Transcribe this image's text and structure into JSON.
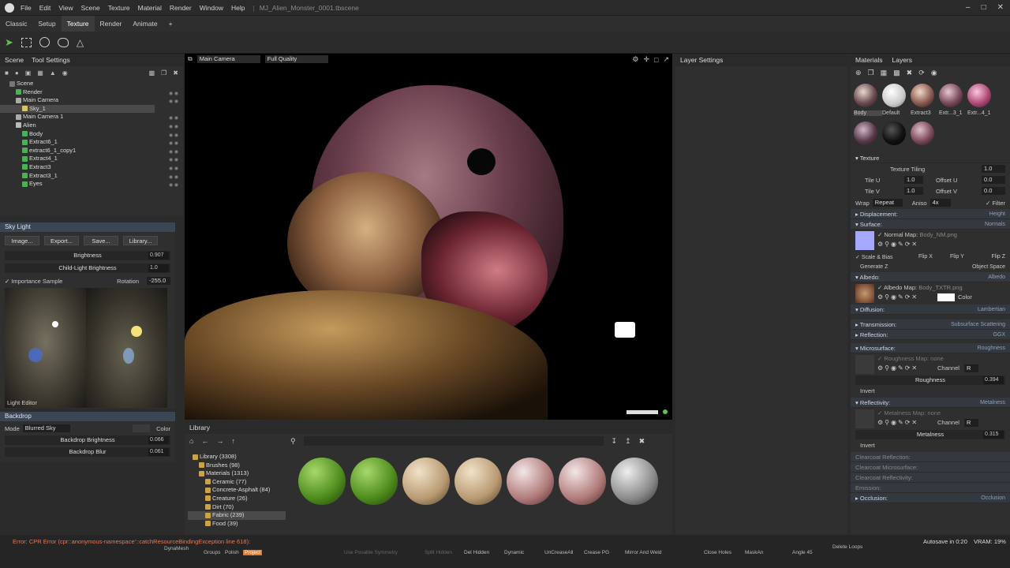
{
  "titlebar": {
    "menu": [
      "File",
      "Edit",
      "View",
      "Scene",
      "Texture",
      "Material",
      "Render",
      "Window",
      "Help"
    ],
    "filename": "MJ_Alien_Monster_0001.tbscene"
  },
  "tabs": [
    "Classic",
    "Setup",
    "Texture",
    "Render",
    "Animate",
    "+"
  ],
  "scene_panel": {
    "tabs": [
      "Scene",
      "Tool Settings"
    ],
    "tree": [
      "Scene",
      "Render",
      "Main Camera",
      "Sky_1",
      "Main Camera 1",
      "Alien",
      "Body",
      "Extract6_1",
      "extract6_1_copy1",
      "Extract4_1",
      "Extract3",
      "Extract3_1",
      "Eyes"
    ]
  },
  "sky_light": {
    "title": "Sky Light",
    "buttons": [
      "Image...",
      "Export...",
      "Save...",
      "Library..."
    ],
    "brightness_label": "Brightness",
    "brightness": "0.907",
    "child_label": "Child-Light Brightness",
    "child": "1.0",
    "importance": "Importance Sample",
    "rotation_label": "Rotation",
    "rotation": "-255.0",
    "light_editor": "Light Editor"
  },
  "backdrop": {
    "title": "Backdrop",
    "mode_label": "Mode",
    "mode": "Blurred Sky",
    "color_label": "Color",
    "brightness_label": "Backdrop Brightness",
    "brightness": "0.066",
    "blur_label": "Backdrop Blur",
    "blur": "0.061"
  },
  "viewport": {
    "camera": "Main Camera",
    "quality": "Full Quality"
  },
  "layer_settings": {
    "title": "Layer Settings"
  },
  "library": {
    "tab": "Library",
    "tree": [
      "Library (3308)",
      "Brushes (98)",
      "Materials (1313)",
      "Ceramic (77)",
      "Concrete-Asphalt (84)",
      "Creature (26)",
      "Dirt (70)",
      "Fabric (239)",
      "Food (39)"
    ]
  },
  "materials": {
    "tabs": [
      "Materials",
      "Layers"
    ],
    "names": [
      "Body",
      "Default",
      "Extract3",
      "Extr...3_1",
      "Extr...4_1"
    ],
    "texture": {
      "title": "Texture",
      "tiling_label": "Texture Tiling",
      "tiling": "1.0",
      "tile_u_label": "Tile U",
      "tile_u": "1.0",
      "offset_u_label": "Offset U",
      "offset_u": "0.0",
      "tile_v_label": "Tile V",
      "tile_v": "1.0",
      "offset_v_label": "Offset V",
      "offset_v": "0.0",
      "wrap_label": "Wrap",
      "wrap": "Repeat",
      "aniso_label": "Aniso",
      "aniso": "4x",
      "filter": "Filter"
    },
    "displacement": {
      "label": "Displacement:",
      "value": "Height"
    },
    "surface": {
      "label": "Surface:",
      "value": "Normals",
      "map": "Normal Map:",
      "file": "Body_NM.png",
      "scale_bias": "Scale & Bias",
      "flip_x": "Flip X",
      "flip_y": "Flip Y",
      "flip_z": "Flip Z",
      "generate_z": "Generate Z",
      "object_space": "Object Space"
    },
    "albedo": {
      "label": "Albedo:",
      "value": "Albedo",
      "map": "Albedo Map:",
      "file": "Body_TXTR.png",
      "color": "Color"
    },
    "diffusion": {
      "label": "Diffusion:",
      "value": "Lambertian"
    },
    "transmission": {
      "label": "Transmission:",
      "value": "Subsurface Scattering"
    },
    "reflection": {
      "label": "Reflection:",
      "value": "GGX"
    },
    "microsurface": {
      "label": "Microsurface:",
      "value": "Roughness",
      "map": "Roughness Map:",
      "file": "none",
      "channel_label": "Channel",
      "channel": "R",
      "slider_label": "Roughness",
      "slider": "0.394",
      "invert": "Invert"
    },
    "reflectivity": {
      "label": "Reflectivity:",
      "value": "Metalness",
      "map": "Metalness Map:",
      "file": "none",
      "channel_label": "Channel",
      "channel": "R",
      "slider_label": "Metalness",
      "slider": "0.315",
      "invert": "Invert"
    },
    "clearcoat": [
      "Clearcoat Reflection:",
      "Clearcoat Microsurface:",
      "Clearcoat Reflectivity:",
      "Emission:"
    ],
    "occlusion": {
      "label": "Occlusion:",
      "value": "Occlusion"
    }
  },
  "status": {
    "error": "Error: CPR Error (cpr::anonymous-namespace'::catchResourceBindingException line 618):",
    "autosave": "Autosave in 0:20",
    "vram": "VRAM: 19%",
    "zbrush": [
      "DynaMesh",
      "Groups",
      "Polish",
      "Project",
      "Use Posable Symmetry",
      "Split Hidden",
      "Del Hidden",
      "Dynamic",
      "UnCreaseAll",
      "Crease PG",
      "Mirror And Weld",
      "Close Holes",
      "MaskAn",
      "Angle 45",
      "Delete Loops"
    ]
  },
  "colors": {
    "accent": "#3c4553",
    "bg": "#2f2f2f",
    "error": "#e07a5f"
  }
}
